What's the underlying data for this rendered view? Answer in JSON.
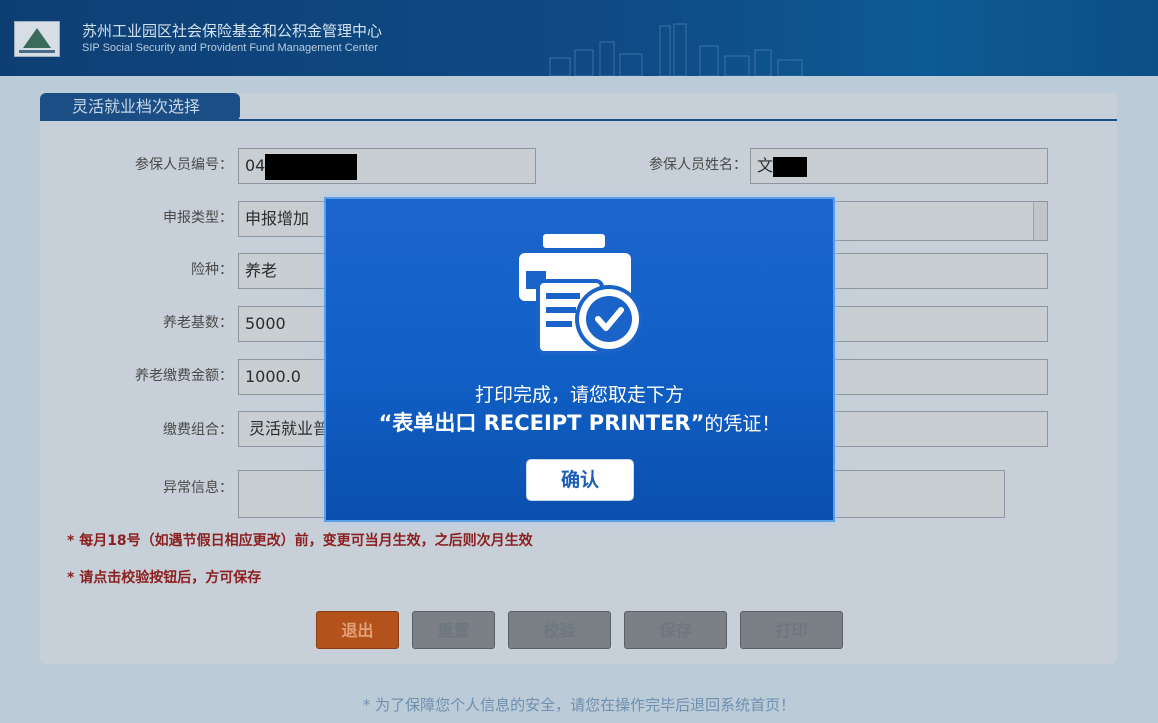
{
  "header": {
    "title_cn": "苏州工业园区社会保险基金和公积金管理中心",
    "title_en": "SIP Social Security and Provident Fund Management Center"
  },
  "form": {
    "tab_label": "灵活就业档次选择",
    "fields": {
      "member_id": {
        "label": "参保人员编号：",
        "value": "04"
      },
      "member_name": {
        "label": "参保人员姓名：",
        "value": "文"
      },
      "report_type": {
        "label": "申报类型：",
        "value": "申报增加"
      },
      "insurance_type": {
        "label": "险种：",
        "value": "养老"
      },
      "pension_base": {
        "label": "养老基数：",
        "value": "5000"
      },
      "pension_amount": {
        "label": "养老缴费金额：",
        "value": "1000.0"
      },
      "payment_combo": {
        "label": "缴费组合：",
        "value": "灵活就业普"
      },
      "error_info": {
        "label": "异常信息：",
        "value": ""
      }
    },
    "notes": [
      "* 每月18号（如遇节假日相应更改）前，变更可当月生效，之后则次月生效",
      "* 请点击校验按钮后，方可保存"
    ],
    "buttons": {
      "exit": "退出",
      "reset": "重置",
      "verify": "校验",
      "save": "保存",
      "print": "打印"
    }
  },
  "footer": "* 为了保障您个人信息的安全，请您在操作完毕后退回系统首页！",
  "modal": {
    "message_line1": "打印完成，请您取走下方",
    "message_bold": "“表单出口 RECEIPT PRINTER”",
    "message_tail": "的凭证！",
    "confirm_label": "确认",
    "icon": "printer-check-icon"
  },
  "colors": {
    "header_bg": "#0f4b86",
    "modal_bg": "#105fc5",
    "exit_button": "#b4521c",
    "note_red": "#8c2020"
  }
}
